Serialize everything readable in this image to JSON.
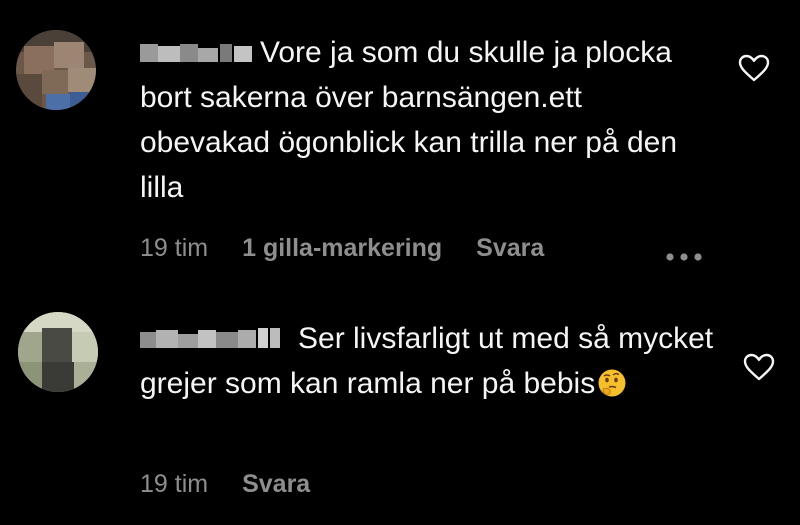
{
  "comments": [
    {
      "text": "Vore ja som du skulle ja plocka bort sakerna över barnsängen.ett obevakad ögonblick kan trilla ner på den lilla",
      "time": "19 tim",
      "likes": "1 gilla-markering",
      "reply": "Svara",
      "more_icon": "ellipsis-icon",
      "like_icon": "heart-outline-icon"
    },
    {
      "text": "Ser livsfarligt ut med så mycket grejer som kan ramla ner på bebis",
      "emoji": "🤔",
      "time": "19 tim",
      "reply": "Svara",
      "like_icon": "heart-outline-icon"
    }
  ],
  "colors": {
    "background": "#000000",
    "text": "#f5f5f5",
    "meta": "#8e8e8e"
  }
}
